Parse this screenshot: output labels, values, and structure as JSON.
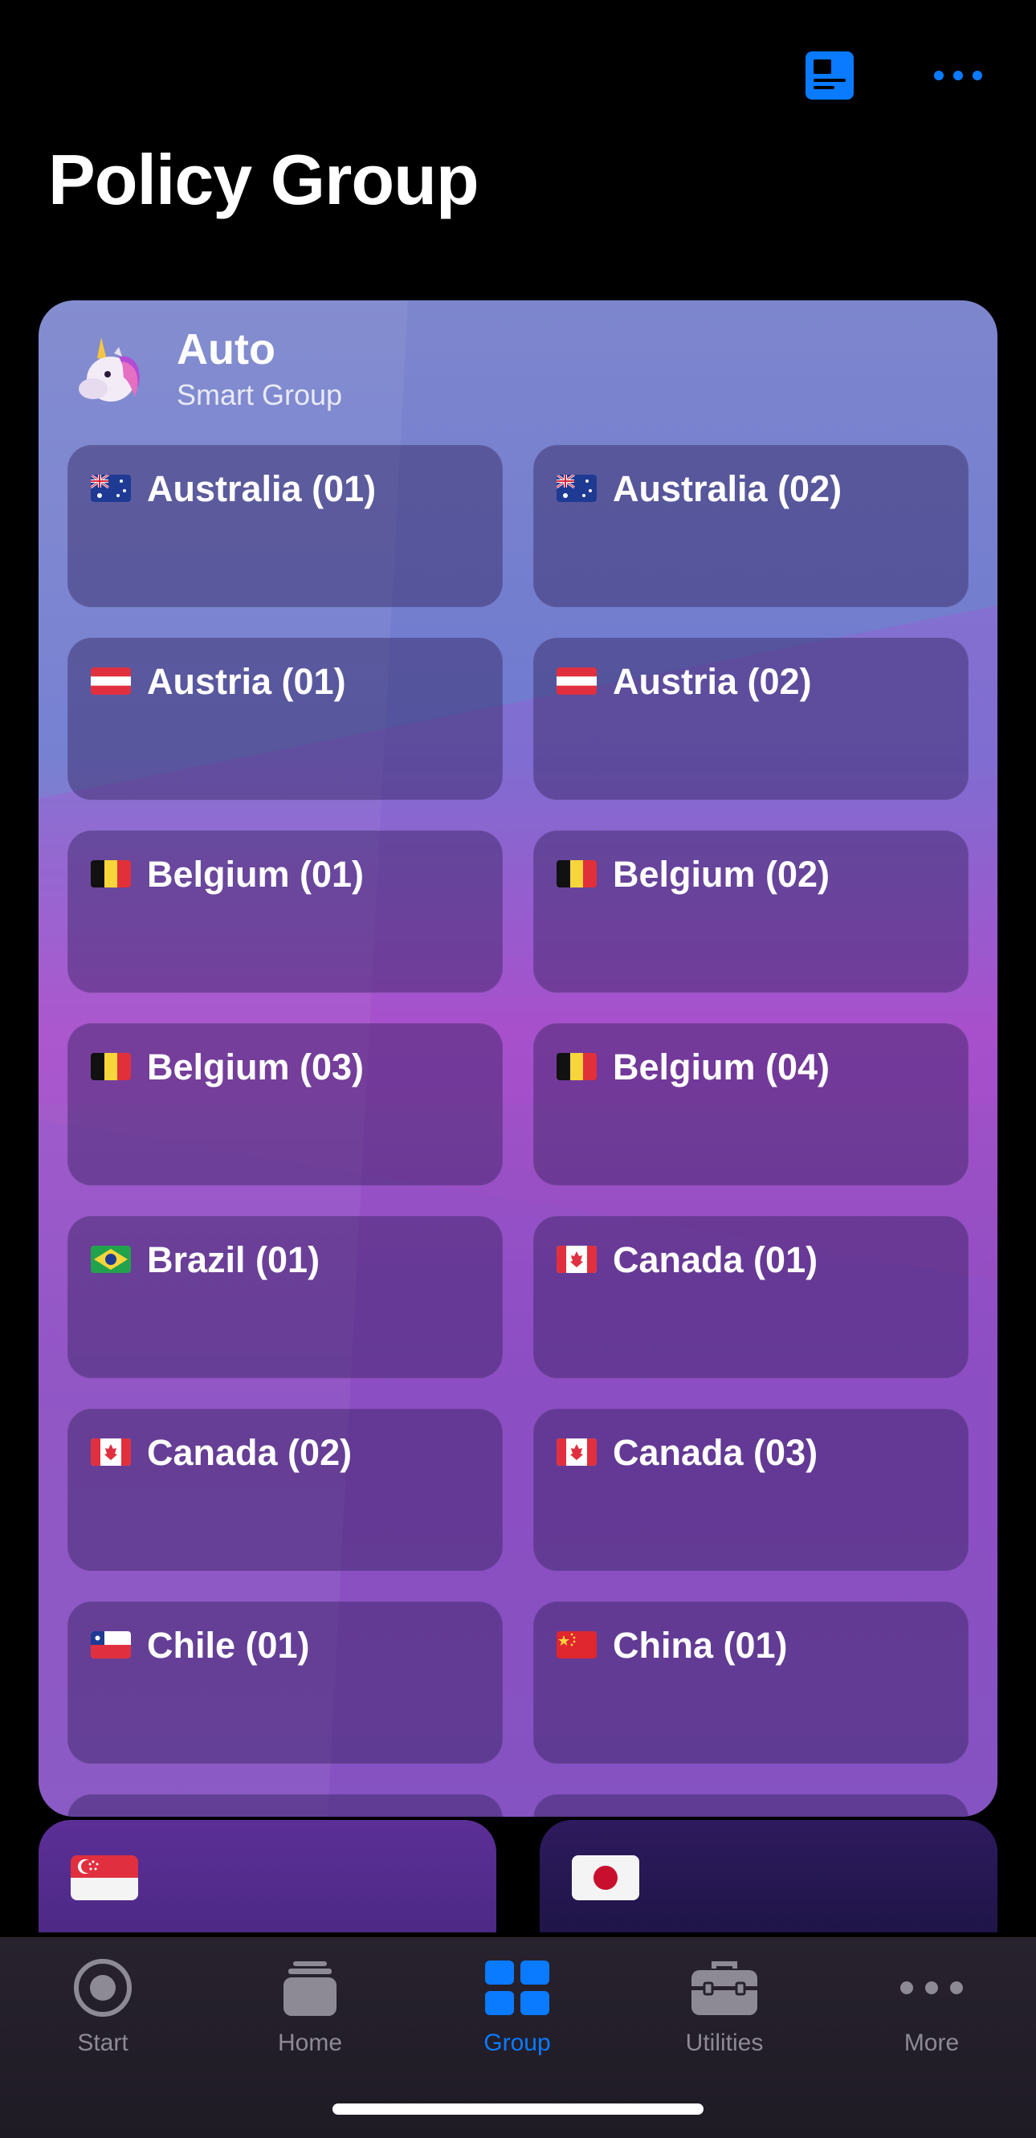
{
  "page": {
    "title": "Policy Group"
  },
  "toolbar": {
    "icons": [
      "document-icon",
      "ellipsis-icon"
    ],
    "accent": "#0a7aff"
  },
  "group": {
    "name": "Auto",
    "type": "Smart Group",
    "avatar_icon": "unicorn-icon",
    "proxies": [
      {
        "name": "Australia (01)",
        "flag": "au"
      },
      {
        "name": "Australia (02)",
        "flag": "au"
      },
      {
        "name": "Austria (01)",
        "flag": "at"
      },
      {
        "name": "Austria (02)",
        "flag": "at"
      },
      {
        "name": "Belgium (01)",
        "flag": "be"
      },
      {
        "name": "Belgium (02)",
        "flag": "be"
      },
      {
        "name": "Belgium (03)",
        "flag": "be"
      },
      {
        "name": "Belgium (04)",
        "flag": "be"
      },
      {
        "name": "Brazil (01)",
        "flag": "br"
      },
      {
        "name": "Canada (01)",
        "flag": "ca"
      },
      {
        "name": "Canada (02)",
        "flag": "ca"
      },
      {
        "name": "Canada (03)",
        "flag": "ca"
      },
      {
        "name": "Chile (01)",
        "flag": "cl"
      },
      {
        "name": "China (01)",
        "flag": "cn"
      }
    ]
  },
  "other_groups": [
    {
      "flag": "sg"
    },
    {
      "flag": "jp"
    }
  ],
  "tab_bar": {
    "tabs": [
      {
        "label": "Start",
        "icon": "record-icon",
        "active": false
      },
      {
        "label": "Home",
        "icon": "stack-icon",
        "active": false
      },
      {
        "label": "Group",
        "icon": "grid-icon",
        "active": true
      },
      {
        "label": "Utilities",
        "icon": "toolbox-icon",
        "active": false
      },
      {
        "label": "More",
        "icon": "ellipsis-icon",
        "active": false
      }
    ]
  }
}
